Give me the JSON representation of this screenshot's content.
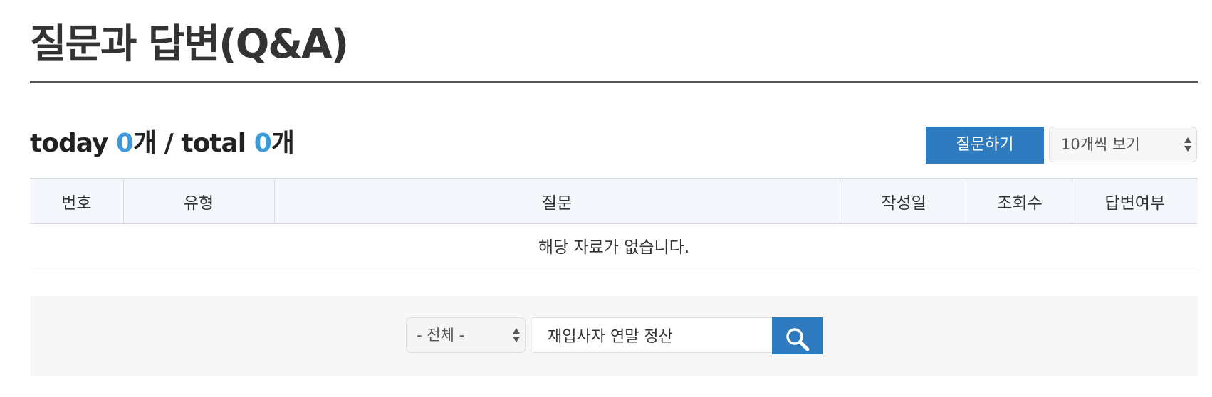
{
  "page": {
    "title": "질문과 답변(Q&A)"
  },
  "counts": {
    "today_label": "today",
    "today_value": "0",
    "total_label": "total",
    "total_value": "0",
    "unit": "개",
    "separator": "/"
  },
  "toolbar": {
    "ask_button_label": "질문하기",
    "per_page_selected": "10개씩 보기"
  },
  "table": {
    "columns": [
      "번호",
      "유형",
      "질문",
      "작성일",
      "조회수",
      "답변여부"
    ],
    "empty_message": "해당 자료가 없습니다."
  },
  "search": {
    "scope_selected": "- 전체 -",
    "query_value": "재입사자 연말 정산",
    "button_icon": "search-icon"
  },
  "colors": {
    "accent": "#2f7bbf",
    "count_number": "#3b9ad9",
    "header_bg": "#f4f8fc",
    "search_bg": "#f7f7f7"
  }
}
